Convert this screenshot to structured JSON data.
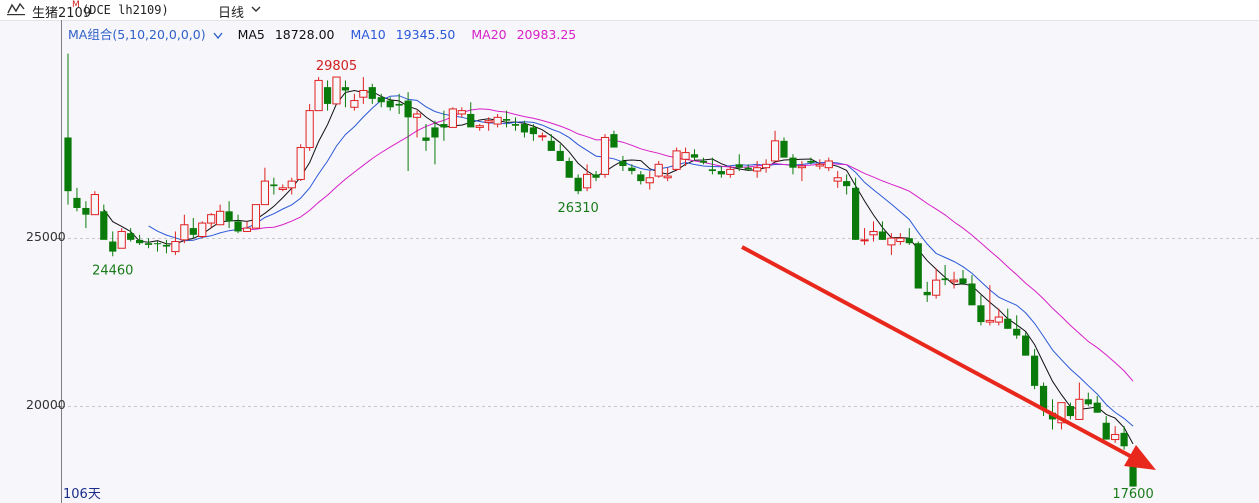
{
  "toolbar": {
    "name": "生猪2109",
    "badge": "M",
    "code": "(DCE lh2109)",
    "period": "日线",
    "colors": {
      "text": "#222222",
      "badge": "#d02020"
    }
  },
  "legend": {
    "group": "MA组合(5,10,20,0,0,0)",
    "ma5_label": "MA5",
    "ma5_value": "18728.00",
    "ma10_label": "MA10",
    "ma10_value": "19345.50",
    "ma20_label": "MA20",
    "ma20_value": "20983.25"
  },
  "footer": {
    "days": "106天"
  },
  "chart_data": {
    "type": "candlestick",
    "instrument": "生猪2109 (DCE lh2109)",
    "period": "日线",
    "y_ticks": [
      25000,
      20000
    ],
    "y_tick_labels": [
      "25000",
      "20000"
    ],
    "ylim": [
      16900,
      31500
    ],
    "grid": "dashed horizontal at y ticks",
    "colors": {
      "up": "#e02020",
      "down": "#0a7a0a",
      "ma5": "#111111",
      "ma10": "#2b58d8",
      "ma20": "#d820c8",
      "arrow": "#e8281c"
    },
    "annotations": [
      {
        "text": "29805",
        "value": 29805,
        "color": "#d02020"
      },
      {
        "text": "24460",
        "value": 24460,
        "color": "#1a7a1a"
      },
      {
        "text": "26310",
        "value": 26310,
        "color": "#1a7a1a"
      },
      {
        "text": "17600",
        "value": 17600,
        "color": "#1a7a1a"
      }
    ],
    "trend_arrow": "red arrow pointing down-right",
    "candles": [
      [
        28000,
        30500,
        26000,
        26400
      ],
      [
        26200,
        26500,
        25800,
        25900
      ],
      [
        25900,
        26100,
        25300,
        25700
      ],
      [
        25700,
        26400,
        25700,
        26300
      ],
      [
        25800,
        26000,
        25000,
        24950
      ],
      [
        24900,
        25200,
        24460,
        24600
      ],
      [
        24700,
        25300,
        24700,
        25200
      ],
      [
        25150,
        25300,
        24900,
        24950
      ],
      [
        24950,
        25100,
        24800,
        24850
      ],
      [
        24850,
        25000,
        24700,
        24800
      ],
      [
        24850,
        24900,
        24600,
        24820
      ],
      [
        24800,
        24950,
        24550,
        24750
      ],
      [
        24600,
        25200,
        24500,
        24900
      ],
      [
        24950,
        25700,
        24850,
        25400
      ],
      [
        25300,
        25600,
        25000,
        25100
      ],
      [
        25050,
        25500,
        25000,
        25450
      ],
      [
        25450,
        25750,
        25300,
        25700
      ],
      [
        25400,
        26000,
        25400,
        25800
      ],
      [
        25800,
        26100,
        25300,
        25500
      ],
      [
        25500,
        25700,
        25150,
        25200
      ],
      [
        25200,
        25500,
        25200,
        25300
      ],
      [
        25300,
        26000,
        25300,
        26000
      ],
      [
        26000,
        27100,
        26000,
        26700
      ],
      [
        26600,
        26800,
        26300,
        26550
      ],
      [
        26450,
        26600,
        26400,
        26500
      ],
      [
        26500,
        26800,
        26300,
        26700
      ],
      [
        26750,
        27800,
        26700,
        27700
      ],
      [
        27700,
        29000,
        27600,
        28800
      ],
      [
        28800,
        29800,
        28800,
        29700
      ],
      [
        29500,
        29700,
        28800,
        29000
      ],
      [
        29000,
        29805,
        29000,
        29800
      ],
      [
        29500,
        29700,
        28900,
        29400
      ],
      [
        28900,
        29300,
        28800,
        29100
      ],
      [
        29200,
        29800,
        29000,
        29400
      ],
      [
        29500,
        29600,
        29000,
        29150
      ],
      [
        29200,
        29300,
        28900,
        29050
      ],
      [
        29100,
        29200,
        28800,
        28900
      ],
      [
        29000,
        29300,
        28700,
        28950
      ],
      [
        29100,
        29350,
        27000,
        28600
      ],
      [
        28600,
        28800,
        28000,
        28700
      ],
      [
        28000,
        28400,
        27600,
        27900
      ],
      [
        28300,
        28500,
        27200,
        28000
      ],
      [
        28400,
        28800,
        27900,
        28300
      ],
      [
        28300,
        28900,
        28300,
        28850
      ],
      [
        28700,
        28900,
        28600,
        28800
      ],
      [
        28700,
        29050,
        28600,
        28300
      ],
      [
        28300,
        28400,
        28200,
        28350
      ],
      [
        28450,
        28600,
        28200,
        28500
      ],
      [
        28400,
        28700,
        28300,
        28600
      ],
      [
        28550,
        28800,
        28300,
        28500
      ],
      [
        28400,
        28600,
        28200,
        28350
      ],
      [
        28400,
        28500,
        28000,
        28150
      ],
      [
        28300,
        28400,
        27900,
        28100
      ],
      [
        28050,
        28150,
        27900,
        28050
      ],
      [
        27900,
        28100,
        27600,
        27600
      ],
      [
        27600,
        27800,
        27300,
        27300
      ],
      [
        27300,
        27400,
        26800,
        26800
      ],
      [
        26800,
        26900,
        26310,
        26400
      ],
      [
        26500,
        27200,
        26400,
        26900
      ],
      [
        26900,
        27000,
        26700,
        26800
      ],
      [
        26900,
        28100,
        26800,
        28000
      ],
      [
        28100,
        28200,
        27700,
        27700
      ],
      [
        27300,
        27450,
        27000,
        27150
      ],
      [
        27100,
        27200,
        26900,
        27000
      ],
      [
        26900,
        27000,
        26600,
        26700
      ],
      [
        26650,
        27000,
        26450,
        26800
      ],
      [
        26850,
        27300,
        26800,
        27200
      ],
      [
        26800,
        27100,
        26700,
        26850
      ],
      [
        27050,
        27700,
        27000,
        27600
      ],
      [
        27350,
        27700,
        27150,
        27550
      ],
      [
        27500,
        27650,
        27300,
        27400
      ],
      [
        27300,
        27400,
        27200,
        27250
      ],
      [
        27050,
        27400,
        26900,
        27000
      ],
      [
        27000,
        27150,
        26800,
        26900
      ],
      [
        26900,
        27150,
        26800,
        27050
      ],
      [
        27200,
        27500,
        27000,
        27100
      ],
      [
        27100,
        27200,
        27000,
        27050
      ],
      [
        27000,
        27300,
        26800,
        27100
      ],
      [
        27100,
        27350,
        26950,
        27200
      ],
      [
        27300,
        28200,
        27300,
        27900
      ],
      [
        27900,
        28000,
        27400,
        27400
      ],
      [
        27400,
        27500,
        26900,
        27100
      ],
      [
        27100,
        27300,
        26700,
        27150
      ],
      [
        27300,
        27400,
        27200,
        27250
      ],
      [
        27150,
        27350,
        27050,
        27200
      ],
      [
        27100,
        27400,
        27000,
        27300
      ],
      [
        26700,
        27000,
        26500,
        26800
      ],
      [
        26700,
        26900,
        26300,
        26550
      ],
      [
        26500,
        26800,
        24950,
        24950
      ],
      [
        24950,
        25300,
        24800,
        24950
      ],
      [
        25100,
        25500,
        24900,
        25200
      ],
      [
        25200,
        25500,
        24950,
        24950
      ],
      [
        24800,
        25150,
        24500,
        25000
      ],
      [
        24900,
        25150,
        24800,
        25000
      ],
      [
        25000,
        25300,
        24800,
        24850
      ],
      [
        24850,
        24900,
        23500,
        23500
      ],
      [
        23400,
        23700,
        23100,
        23300
      ],
      [
        23300,
        24100,
        23200,
        23750
      ],
      [
        23800,
        24200,
        23600,
        23750
      ],
      [
        23700,
        24000,
        23500,
        23750
      ],
      [
        23800,
        24050,
        23600,
        23650
      ],
      [
        23650,
        23900,
        23100,
        23000
      ],
      [
        23000,
        23300,
        22400,
        22500
      ],
      [
        22500,
        23600,
        22400,
        22550
      ],
      [
        22500,
        22900,
        22400,
        22650
      ],
      [
        22600,
        22900,
        22300,
        22300
      ],
      [
        22300,
        22700,
        22000,
        22100
      ],
      [
        22100,
        22200,
        21500,
        21500
      ],
      [
        21500,
        21700,
        20500,
        20600
      ],
      [
        20600,
        20700,
        19700,
        19900
      ],
      [
        19800,
        20200,
        19300,
        19600
      ],
      [
        19500,
        20100,
        19300,
        20100
      ],
      [
        20000,
        20100,
        19600,
        19700
      ],
      [
        19600,
        20700,
        19600,
        20200
      ],
      [
        20200,
        20400,
        20000,
        20050
      ],
      [
        20100,
        20300,
        19800,
        19800
      ],
      [
        19500,
        19700,
        19000,
        19000
      ],
      [
        19000,
        19400,
        18900,
        19150
      ],
      [
        19200,
        19400,
        18700,
        18800
      ],
      [
        18400,
        18600,
        17600,
        17600
      ]
    ]
  }
}
